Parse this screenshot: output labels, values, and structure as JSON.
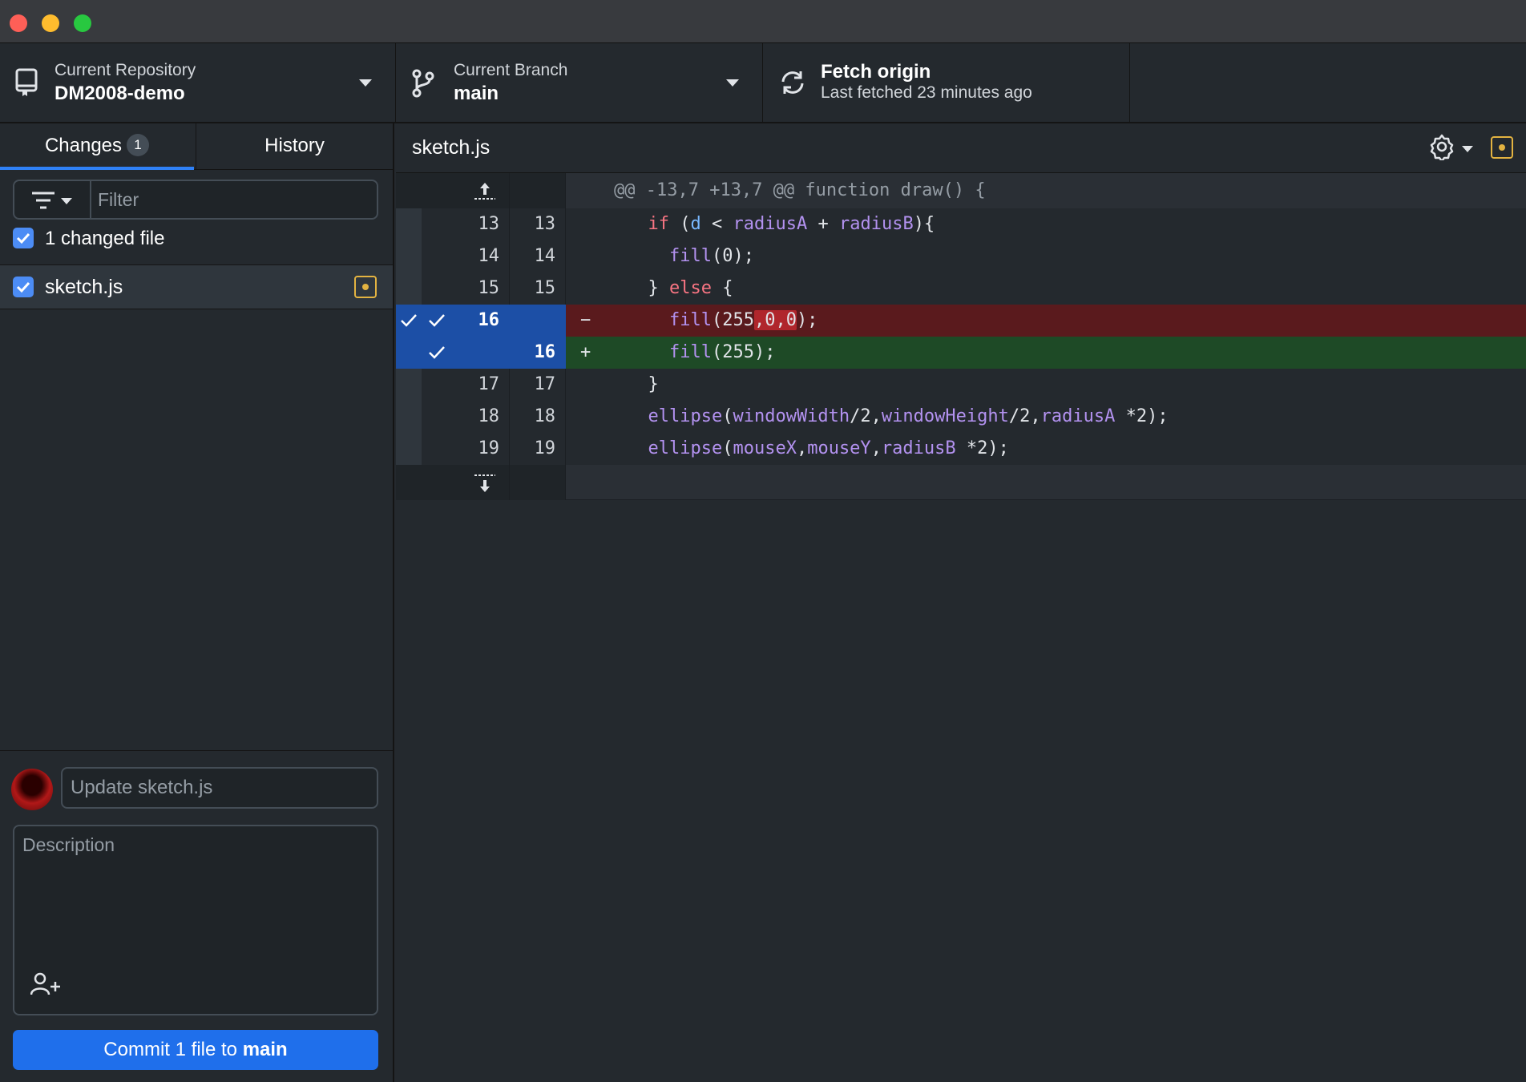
{
  "toolbar": {
    "repo_label": "Current Repository",
    "repo_name": "DM2008-demo",
    "branch_label": "Current Branch",
    "branch_name": "main",
    "fetch_label": "Fetch origin",
    "fetch_sub": "Last fetched 23 minutes ago"
  },
  "sidebar": {
    "tabs": [
      {
        "label": "Changes",
        "badge": "1"
      },
      {
        "label": "History"
      }
    ],
    "filter_placeholder": "Filter",
    "changed_files_label": "1 changed file",
    "files": [
      {
        "name": "sketch.js",
        "status": "modified"
      }
    ]
  },
  "commit": {
    "summary_placeholder": "Update sketch.js",
    "description_placeholder": "Description",
    "button_prefix": "Commit 1 file to ",
    "button_branch": "main"
  },
  "diff": {
    "file": "sketch.js",
    "hunk_header": "@@ -13,7 +13,7 @@ function draw() {",
    "lines": [
      {
        "old": "13",
        "new": "13",
        "marker": " "
      },
      {
        "old": "14",
        "new": "14",
        "marker": " "
      },
      {
        "old": "15",
        "new": "15",
        "marker": " "
      },
      {
        "old": "16",
        "new": "",
        "marker": "−"
      },
      {
        "old": "",
        "new": "16",
        "marker": "+"
      },
      {
        "old": "17",
        "new": "17",
        "marker": " "
      },
      {
        "old": "18",
        "new": "18",
        "marker": " "
      },
      {
        "old": "19",
        "new": "19",
        "marker": " "
      }
    ]
  },
  "colors": {
    "accent": "#1f6feb",
    "deleted_bg": "#5a1a1d",
    "added_bg": "#1e4a26",
    "modified_icon": "#e3b341"
  }
}
